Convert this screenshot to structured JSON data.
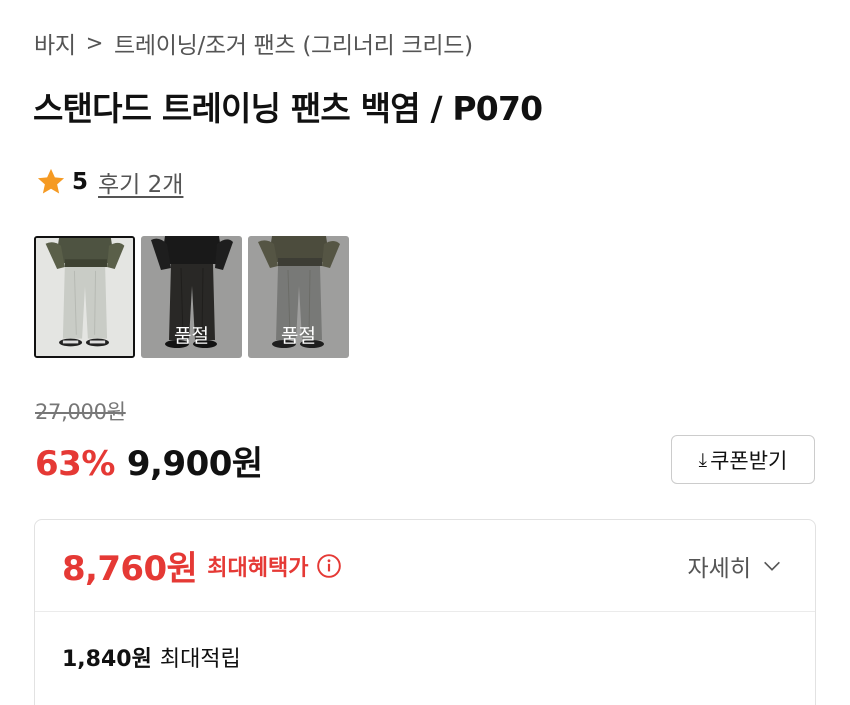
{
  "breadcrumb": {
    "category": "바지",
    "separator": ">",
    "subcategory": "트레이닝/조거 팬츠 (그리너리 크리드)"
  },
  "product": {
    "title": "스탠다드 트레이닝 팬츠 백염 / P070"
  },
  "rating": {
    "icon": "star-icon",
    "score": "5",
    "reviews": "후기 2개",
    "star_color": "#f59a23"
  },
  "thumbnails": [
    {
      "variant": "light-gray-pants",
      "sold_out": "",
      "selected": true
    },
    {
      "variant": "charcoal-pants",
      "sold_out": "품절",
      "selected": false
    },
    {
      "variant": "gray-pants",
      "sold_out": "품절",
      "selected": false
    }
  ],
  "pricing": {
    "original": "27,000원",
    "discount": "63%",
    "sale": "9,900원",
    "coupon_label": "쿠폰받기",
    "coupon_icon": "download-icon",
    "accent_color": "#e53935"
  },
  "benefits": {
    "max_price": "8,760원",
    "max_label": "최대혜택가",
    "info_icon": "info-icon",
    "details_label": "자세히",
    "details_icon": "chevron-down-icon",
    "points": "1,840원",
    "points_label": "최대적립"
  }
}
